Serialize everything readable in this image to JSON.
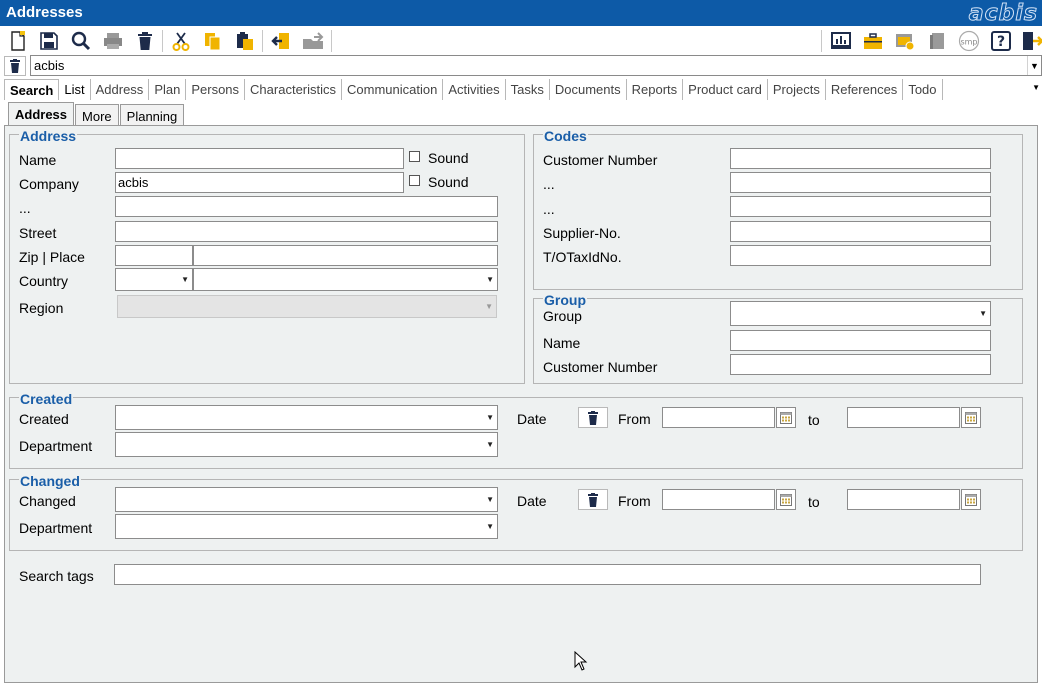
{
  "window": {
    "title": "Addresses",
    "logo": "acbis"
  },
  "toolbar": {
    "left_icons": [
      "new-document-icon",
      "save-icon",
      "search-icon",
      "print-icon",
      "delete-icon",
      "cut-icon",
      "copy-icon",
      "paste-icon",
      "import-icon",
      "export-icon"
    ],
    "right_icons": [
      "presentation-icon",
      "briefcase-icon",
      "window-check-icon",
      "book-icon",
      "smp-icon",
      "help-icon",
      "exit-icon"
    ],
    "smp_text": "smp",
    "help_text": "?"
  },
  "search": {
    "value": "acbis"
  },
  "tabs": [
    "Search",
    "List",
    "Address",
    "Plan",
    "Persons",
    "Characteristics",
    "Communication",
    "Activities",
    "Tasks",
    "Documents",
    "Reports",
    "Product card",
    "Projects",
    "References",
    "Todo"
  ],
  "subtabs": [
    "Address",
    "More",
    "Planning"
  ],
  "address": {
    "legend": "Address",
    "name_label": "Name",
    "company_label": "Company",
    "company_value": "acbis",
    "dots_label": "...",
    "street_label": "Street",
    "zip_label": "Zip | Place",
    "country_label": "Country",
    "region_label": "Region",
    "sound_label": "Sound"
  },
  "codes": {
    "legend": "Codes",
    "customer_number_label": "Customer Number",
    "dots1_label": "...",
    "dots2_label": "...",
    "supplier_label": "Supplier-No.",
    "taxid_label": "T/OTaxIdNo."
  },
  "group": {
    "legend": "Group",
    "group_label": "Group",
    "name_label": "Name",
    "customer_number_label": "Customer Number"
  },
  "created": {
    "legend": "Created",
    "created_label": "Created",
    "department_label": "Department",
    "date_label": "Date",
    "from_label": "From",
    "to_label": "to"
  },
  "changed": {
    "legend": "Changed",
    "changed_label": "Changed",
    "department_label": "Department",
    "date_label": "Date",
    "from_label": "From",
    "to_label": "to"
  },
  "search_tags": {
    "label": "Search tags"
  }
}
